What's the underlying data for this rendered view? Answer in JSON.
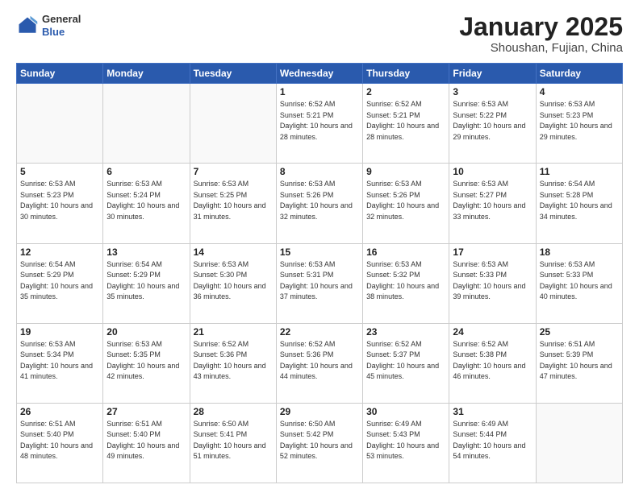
{
  "header": {
    "logo": {
      "general": "General",
      "blue": "Blue"
    },
    "title": "January 2025",
    "location": "Shoushan, Fujian, China"
  },
  "days_of_week": [
    "Sunday",
    "Monday",
    "Tuesday",
    "Wednesday",
    "Thursday",
    "Friday",
    "Saturday"
  ],
  "weeks": [
    [
      {
        "day": null
      },
      {
        "day": null
      },
      {
        "day": null
      },
      {
        "day": 1,
        "sunrise": "Sunrise: 6:52 AM",
        "sunset": "Sunset: 5:21 PM",
        "daylight": "Daylight: 10 hours and 28 minutes."
      },
      {
        "day": 2,
        "sunrise": "Sunrise: 6:52 AM",
        "sunset": "Sunset: 5:21 PM",
        "daylight": "Daylight: 10 hours and 28 minutes."
      },
      {
        "day": 3,
        "sunrise": "Sunrise: 6:53 AM",
        "sunset": "Sunset: 5:22 PM",
        "daylight": "Daylight: 10 hours and 29 minutes."
      },
      {
        "day": 4,
        "sunrise": "Sunrise: 6:53 AM",
        "sunset": "Sunset: 5:23 PM",
        "daylight": "Daylight: 10 hours and 29 minutes."
      }
    ],
    [
      {
        "day": 5,
        "sunrise": "Sunrise: 6:53 AM",
        "sunset": "Sunset: 5:23 PM",
        "daylight": "Daylight: 10 hours and 30 minutes."
      },
      {
        "day": 6,
        "sunrise": "Sunrise: 6:53 AM",
        "sunset": "Sunset: 5:24 PM",
        "daylight": "Daylight: 10 hours and 30 minutes."
      },
      {
        "day": 7,
        "sunrise": "Sunrise: 6:53 AM",
        "sunset": "Sunset: 5:25 PM",
        "daylight": "Daylight: 10 hours and 31 minutes."
      },
      {
        "day": 8,
        "sunrise": "Sunrise: 6:53 AM",
        "sunset": "Sunset: 5:26 PM",
        "daylight": "Daylight: 10 hours and 32 minutes."
      },
      {
        "day": 9,
        "sunrise": "Sunrise: 6:53 AM",
        "sunset": "Sunset: 5:26 PM",
        "daylight": "Daylight: 10 hours and 32 minutes."
      },
      {
        "day": 10,
        "sunrise": "Sunrise: 6:53 AM",
        "sunset": "Sunset: 5:27 PM",
        "daylight": "Daylight: 10 hours and 33 minutes."
      },
      {
        "day": 11,
        "sunrise": "Sunrise: 6:54 AM",
        "sunset": "Sunset: 5:28 PM",
        "daylight": "Daylight: 10 hours and 34 minutes."
      }
    ],
    [
      {
        "day": 12,
        "sunrise": "Sunrise: 6:54 AM",
        "sunset": "Sunset: 5:29 PM",
        "daylight": "Daylight: 10 hours and 35 minutes."
      },
      {
        "day": 13,
        "sunrise": "Sunrise: 6:54 AM",
        "sunset": "Sunset: 5:29 PM",
        "daylight": "Daylight: 10 hours and 35 minutes."
      },
      {
        "day": 14,
        "sunrise": "Sunrise: 6:53 AM",
        "sunset": "Sunset: 5:30 PM",
        "daylight": "Daylight: 10 hours and 36 minutes."
      },
      {
        "day": 15,
        "sunrise": "Sunrise: 6:53 AM",
        "sunset": "Sunset: 5:31 PM",
        "daylight": "Daylight: 10 hours and 37 minutes."
      },
      {
        "day": 16,
        "sunrise": "Sunrise: 6:53 AM",
        "sunset": "Sunset: 5:32 PM",
        "daylight": "Daylight: 10 hours and 38 minutes."
      },
      {
        "day": 17,
        "sunrise": "Sunrise: 6:53 AM",
        "sunset": "Sunset: 5:33 PM",
        "daylight": "Daylight: 10 hours and 39 minutes."
      },
      {
        "day": 18,
        "sunrise": "Sunrise: 6:53 AM",
        "sunset": "Sunset: 5:33 PM",
        "daylight": "Daylight: 10 hours and 40 minutes."
      }
    ],
    [
      {
        "day": 19,
        "sunrise": "Sunrise: 6:53 AM",
        "sunset": "Sunset: 5:34 PM",
        "daylight": "Daylight: 10 hours and 41 minutes."
      },
      {
        "day": 20,
        "sunrise": "Sunrise: 6:53 AM",
        "sunset": "Sunset: 5:35 PM",
        "daylight": "Daylight: 10 hours and 42 minutes."
      },
      {
        "day": 21,
        "sunrise": "Sunrise: 6:52 AM",
        "sunset": "Sunset: 5:36 PM",
        "daylight": "Daylight: 10 hours and 43 minutes."
      },
      {
        "day": 22,
        "sunrise": "Sunrise: 6:52 AM",
        "sunset": "Sunset: 5:36 PM",
        "daylight": "Daylight: 10 hours and 44 minutes."
      },
      {
        "day": 23,
        "sunrise": "Sunrise: 6:52 AM",
        "sunset": "Sunset: 5:37 PM",
        "daylight": "Daylight: 10 hours and 45 minutes."
      },
      {
        "day": 24,
        "sunrise": "Sunrise: 6:52 AM",
        "sunset": "Sunset: 5:38 PM",
        "daylight": "Daylight: 10 hours and 46 minutes."
      },
      {
        "day": 25,
        "sunrise": "Sunrise: 6:51 AM",
        "sunset": "Sunset: 5:39 PM",
        "daylight": "Daylight: 10 hours and 47 minutes."
      }
    ],
    [
      {
        "day": 26,
        "sunrise": "Sunrise: 6:51 AM",
        "sunset": "Sunset: 5:40 PM",
        "daylight": "Daylight: 10 hours and 48 minutes."
      },
      {
        "day": 27,
        "sunrise": "Sunrise: 6:51 AM",
        "sunset": "Sunset: 5:40 PM",
        "daylight": "Daylight: 10 hours and 49 minutes."
      },
      {
        "day": 28,
        "sunrise": "Sunrise: 6:50 AM",
        "sunset": "Sunset: 5:41 PM",
        "daylight": "Daylight: 10 hours and 51 minutes."
      },
      {
        "day": 29,
        "sunrise": "Sunrise: 6:50 AM",
        "sunset": "Sunset: 5:42 PM",
        "daylight": "Daylight: 10 hours and 52 minutes."
      },
      {
        "day": 30,
        "sunrise": "Sunrise: 6:49 AM",
        "sunset": "Sunset: 5:43 PM",
        "daylight": "Daylight: 10 hours and 53 minutes."
      },
      {
        "day": 31,
        "sunrise": "Sunrise: 6:49 AM",
        "sunset": "Sunset: 5:44 PM",
        "daylight": "Daylight: 10 hours and 54 minutes."
      },
      {
        "day": null
      }
    ]
  ]
}
